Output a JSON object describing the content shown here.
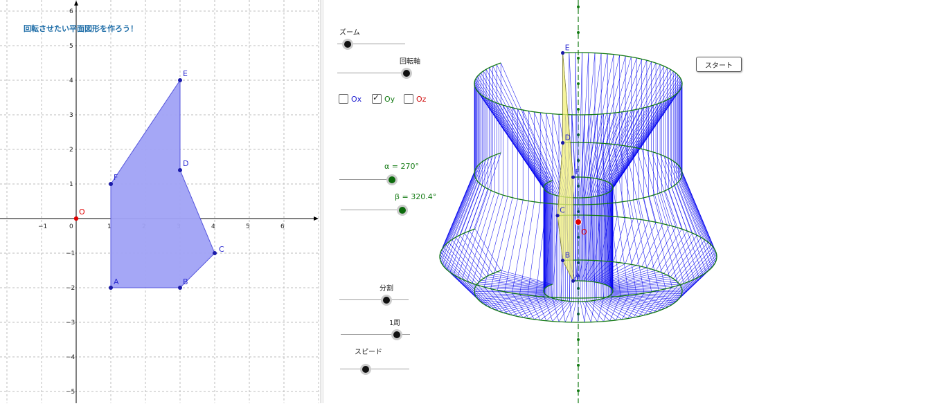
{
  "graphics": {
    "title": "回転させたい平面図形を作ろう！",
    "x_ticks": [
      "−1",
      "0",
      "1",
      "2",
      "3",
      "4",
      "5",
      "6"
    ],
    "y_ticks": [
      "6",
      "5",
      "4",
      "3",
      "2",
      "1",
      "−1",
      "−2",
      "−3",
      "−4",
      "−5"
    ],
    "origin_label": "O",
    "points": [
      {
        "name": "A",
        "x": 1,
        "y": -2
      },
      {
        "name": "B",
        "x": 3,
        "y": -2
      },
      {
        "name": "C",
        "x": 4,
        "y": -1
      },
      {
        "name": "D",
        "x": 3,
        "y": 1.4
      },
      {
        "name": "E",
        "x": 3,
        "y": 4
      },
      {
        "name": "F",
        "x": 1,
        "y": 1
      }
    ],
    "polygon_color": "#a0a2f5",
    "point_color": "#1a1aa8",
    "origin_color": "#e00000"
  },
  "controls": {
    "zoom_label": "ズーム",
    "axis_label": "回転軸",
    "checkboxes": [
      {
        "label": "Ox",
        "checked": false,
        "color": "#1a1ad0"
      },
      {
        "label": "Oy",
        "checked": true,
        "color": "#137a13"
      },
      {
        "label": "Oz",
        "checked": false,
        "color": "#d01010"
      }
    ],
    "alpha_label": "α = 270°",
    "beta_label": "β = 320.4°",
    "divisions_label": "分割",
    "one_turn_label": "1周",
    "speed_label": "スピード",
    "start_label": "スタート"
  },
  "view3d": {
    "labels": [
      "E",
      "F",
      "D",
      "A",
      "C",
      "B",
      "O"
    ],
    "mesh_color": "#0000ee",
    "edge_color": "#137a13",
    "axis_color": "#137a13",
    "shape_fill": "#f2f07a"
  }
}
